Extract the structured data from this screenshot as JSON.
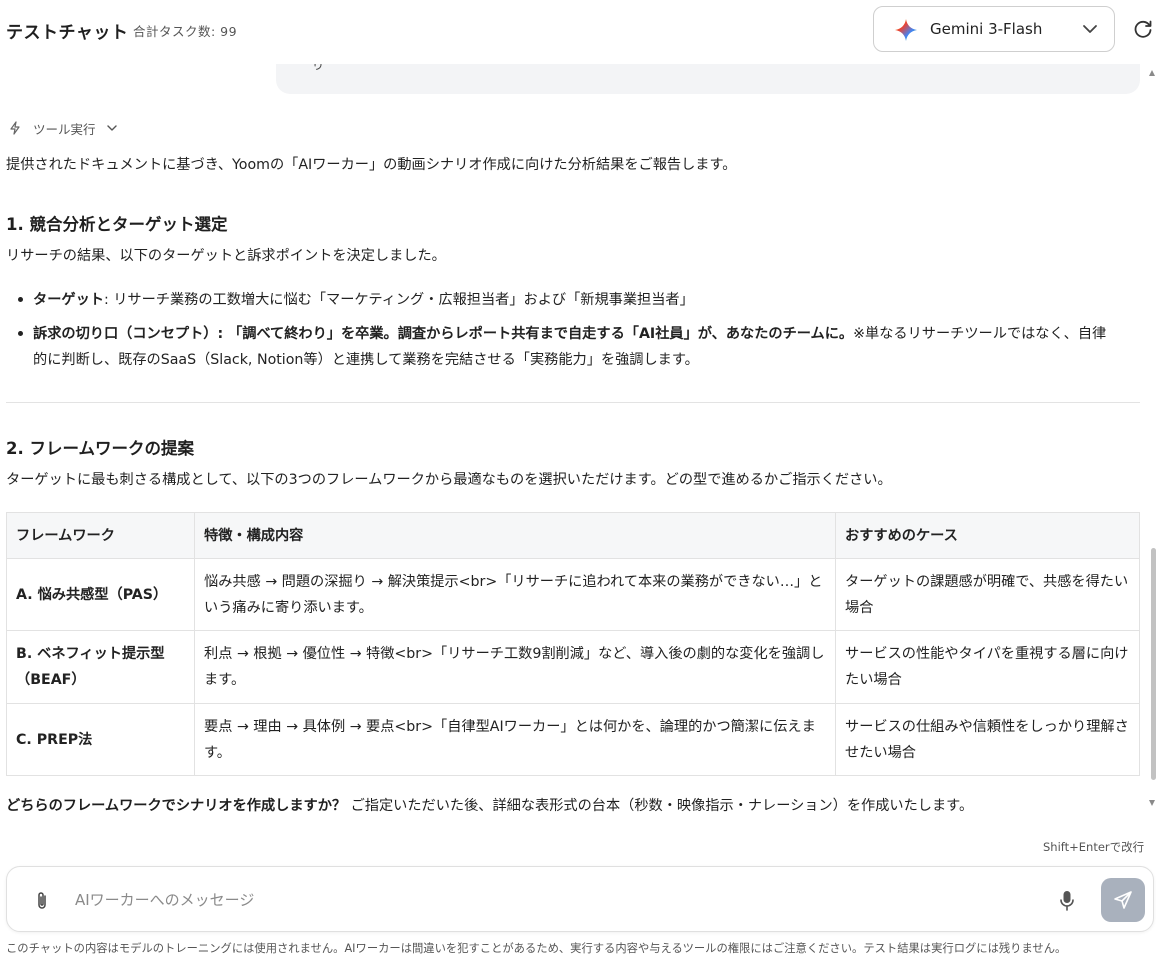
{
  "header": {
    "title": "テストチャット",
    "task_count": "合計タスク数: 99",
    "model_name": "Gemini 3-Flash"
  },
  "user_bubble": {
    "fragment": "り"
  },
  "tool_run": {
    "label": "ツール実行"
  },
  "message": {
    "intro": "提供されたドキュメントに基づき、Yoomの「AIワーカー」の動画シナリオ作成に向けた分析結果をご報告します。",
    "section1": {
      "heading": "1. 競合分析とターゲット選定",
      "lead": "リサーチの結果、以下のターゲットと訴求ポイントを決定しました。",
      "target_label": "ターゲット",
      "target_text": ": リサーチ業務の工数増大に悩む「マーケティング・広報担当者」および「新規事業担当者」",
      "concept_label": "訴求の切り口（コンセプト）",
      "concept_bold": ": 「調べて終わり」を卒業。調査からレポート共有まで自走する「AI社員」が、あなたのチームに。",
      "concept_rest_line1": "※単なるリサーチツールではなく、自律",
      "concept_rest_line2": "的に判断し、既存のSaaS（Slack, Notion等）と連携して業務を完結させる「実務能力」を強調します。"
    },
    "section2": {
      "heading": "2. フレームワークの提案",
      "lead": "ターゲットに最も刺さる構成として、以下の3つのフレームワークから最適なものを選択いただけます。どの型で進めるかご指示ください。",
      "table": {
        "headers": [
          "フレームワーク",
          "特徴・構成内容",
          "おすすめのケース"
        ],
        "rows": [
          {
            "name": "A. 悩み共感型（PAS）",
            "desc": "悩み共感 → 問題の深掘り → 解決策提示<br>「リサーチに追われて本来の業務ができない…」という痛みに寄り添います。",
            "case": "ターゲットの課題感が明確で、共感を得たい場合"
          },
          {
            "name": "B. ベネフィット提示型（BEAF）",
            "desc": "利点 → 根拠 → 優位性 → 特徴<br>「リサーチ工数9割削減」など、導入後の劇的な変化を強調します。",
            "case": "サービスの性能やタイパを重視する層に向けたい場合"
          },
          {
            "name": "C. PREP法",
            "desc": "要点 → 理由 → 具体例 → 要点<br>「自律型AIワーカー」とは何かを、論理的かつ簡潔に伝えます。",
            "case": "サービスの仕組みや信頼性をしっかり理解させたい場合"
          }
        ]
      }
    },
    "question_bold": "どちらのフレームワークでシナリオを作成しますか？",
    "question_rest": " ご指定いただいた後、詳細な表形式の台本（秒数・映像指示・ナレーション）を作成いたします。"
  },
  "composer": {
    "hint": "Shift+Enterで改行",
    "placeholder": "AIワーカーへのメッセージ",
    "value": ""
  },
  "footer": {
    "disclaimer": "このチャットの内容はモデルのトレーニングには使用されません。AIワーカーは間違いを犯すことがあるため、実行する内容や与えるツールの権限にはご注意ください。テスト結果は実行ログには残りません。"
  },
  "colors": {
    "send_button": "#a9b1bd",
    "table_header_bg": "#f6f7f8",
    "user_bubble_bg": "#f3f4f6"
  },
  "icons": [
    "gemini-star-icon",
    "chevron-down-icon",
    "refresh-icon",
    "bolt-icon",
    "paperclip-icon",
    "microphone-icon",
    "send-icon"
  ]
}
